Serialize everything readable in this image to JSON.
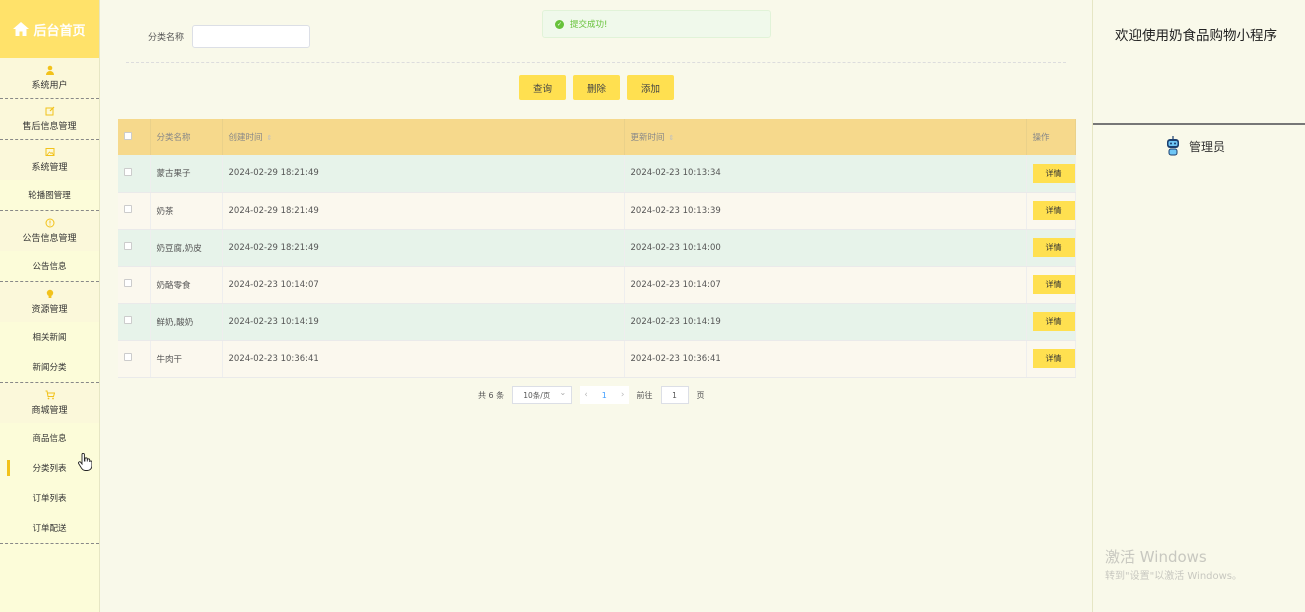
{
  "sidebar": {
    "brand": "后台首页",
    "groups": [
      {
        "label": "系统用户",
        "icon": "user-icon",
        "subs": []
      },
      {
        "label": "售后信息管理",
        "icon": "edit-icon",
        "subs": []
      },
      {
        "label": "系统管理",
        "icon": "image-icon",
        "subs": [
          "轮播图管理"
        ]
      },
      {
        "label": "公告信息管理",
        "icon": "info-icon",
        "subs": [
          "公告信息"
        ]
      },
      {
        "label": "资源管理",
        "icon": "bulb-icon",
        "subs": [
          "相关新闻",
          "新闻分类"
        ]
      },
      {
        "label": "商城管理",
        "icon": "cart-icon",
        "subs": [
          "商品信息",
          "分类列表",
          "订单列表",
          "订单配送"
        ]
      }
    ],
    "active_item": "分类列表"
  },
  "search": {
    "label": "分类名称",
    "value": ""
  },
  "toast": "提交成功!",
  "buttons": {
    "query": "查询",
    "delete": "删除",
    "add": "添加"
  },
  "table": {
    "headers": {
      "name": "分类名称",
      "created": "创建时间",
      "updated": "更新时间",
      "action": "操作"
    },
    "rows": [
      {
        "name": "蒙古果子",
        "created": "2024-02-29 18:21:49",
        "updated": "2024-02-23 10:13:34"
      },
      {
        "name": "奶茶",
        "created": "2024-02-29 18:21:49",
        "updated": "2024-02-23 10:13:39"
      },
      {
        "name": "奶豆腐,奶皮",
        "created": "2024-02-29 18:21:49",
        "updated": "2024-02-23 10:14:00"
      },
      {
        "name": "奶酪零食",
        "created": "2024-02-23 10:14:07",
        "updated": "2024-02-23 10:14:07"
      },
      {
        "name": "鲜奶,酸奶",
        "created": "2024-02-23 10:14:19",
        "updated": "2024-02-23 10:14:19"
      },
      {
        "name": "牛肉干",
        "created": "2024-02-23 10:36:41",
        "updated": "2024-02-23 10:36:41"
      }
    ],
    "detail_label": "详情"
  },
  "pager": {
    "total": "共 6 条",
    "page_size": "10条/页",
    "current": "1",
    "goto_prefix": "前往",
    "goto_value": "1",
    "goto_suffix": "页"
  },
  "right": {
    "welcome": "欢迎使用奶食品购物小程序",
    "admin": "管理员"
  },
  "watermark": {
    "line1": "激活 Windows",
    "line2": "转到\"设置\"以激活 Windows。"
  }
}
